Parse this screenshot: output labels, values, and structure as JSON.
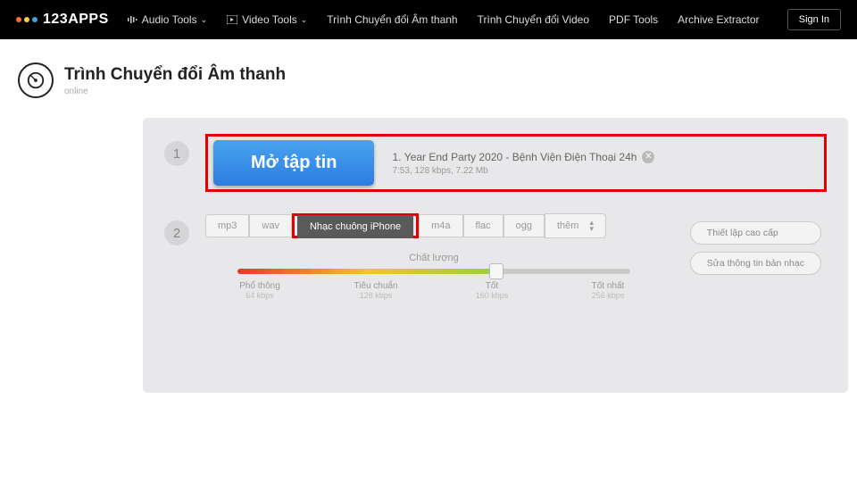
{
  "header": {
    "brand": "123APPS",
    "nav": {
      "audio": "Audio Tools",
      "video": "Video Tools",
      "audio_conv": "Trình Chuyển đổi Âm thanh",
      "video_conv": "Trình Chuyển đổi Video",
      "pdf": "PDF Tools",
      "archive": "Archive Extractor"
    },
    "signin": "Sign In"
  },
  "page": {
    "title": "Trình Chuyển đổi Âm thanh",
    "subtitle": "online"
  },
  "step1": {
    "num": "1",
    "open_btn": "Mở tập tin",
    "file_prefix": "1.",
    "file_name": "Year End Party 2020 - Bệnh Viện Điện Thoại 24h",
    "file_meta": "7:53, 128 kbps, 7.22 Mb"
  },
  "step2": {
    "num": "2",
    "formats": {
      "mp3": "mp3",
      "wav": "wav",
      "iphone": "Nhạc chuông iPhone",
      "m4a": "m4a",
      "flac": "flac",
      "ogg": "ogg",
      "more": "thêm"
    },
    "quality": {
      "title": "Chất lượng",
      "labels": {
        "l1": "Phổ thông",
        "l1k": "64 kbps",
        "l2": "Tiêu chuẩn",
        "l2k": "128 kbps",
        "l3": "Tốt",
        "l3k": "160 kbps",
        "l4": "Tốt nhất",
        "l4k": "256 kbps"
      }
    },
    "side": {
      "advanced": "Thiết lập cao cấp",
      "edit": "Sửa thông tin bản nhạc"
    }
  }
}
